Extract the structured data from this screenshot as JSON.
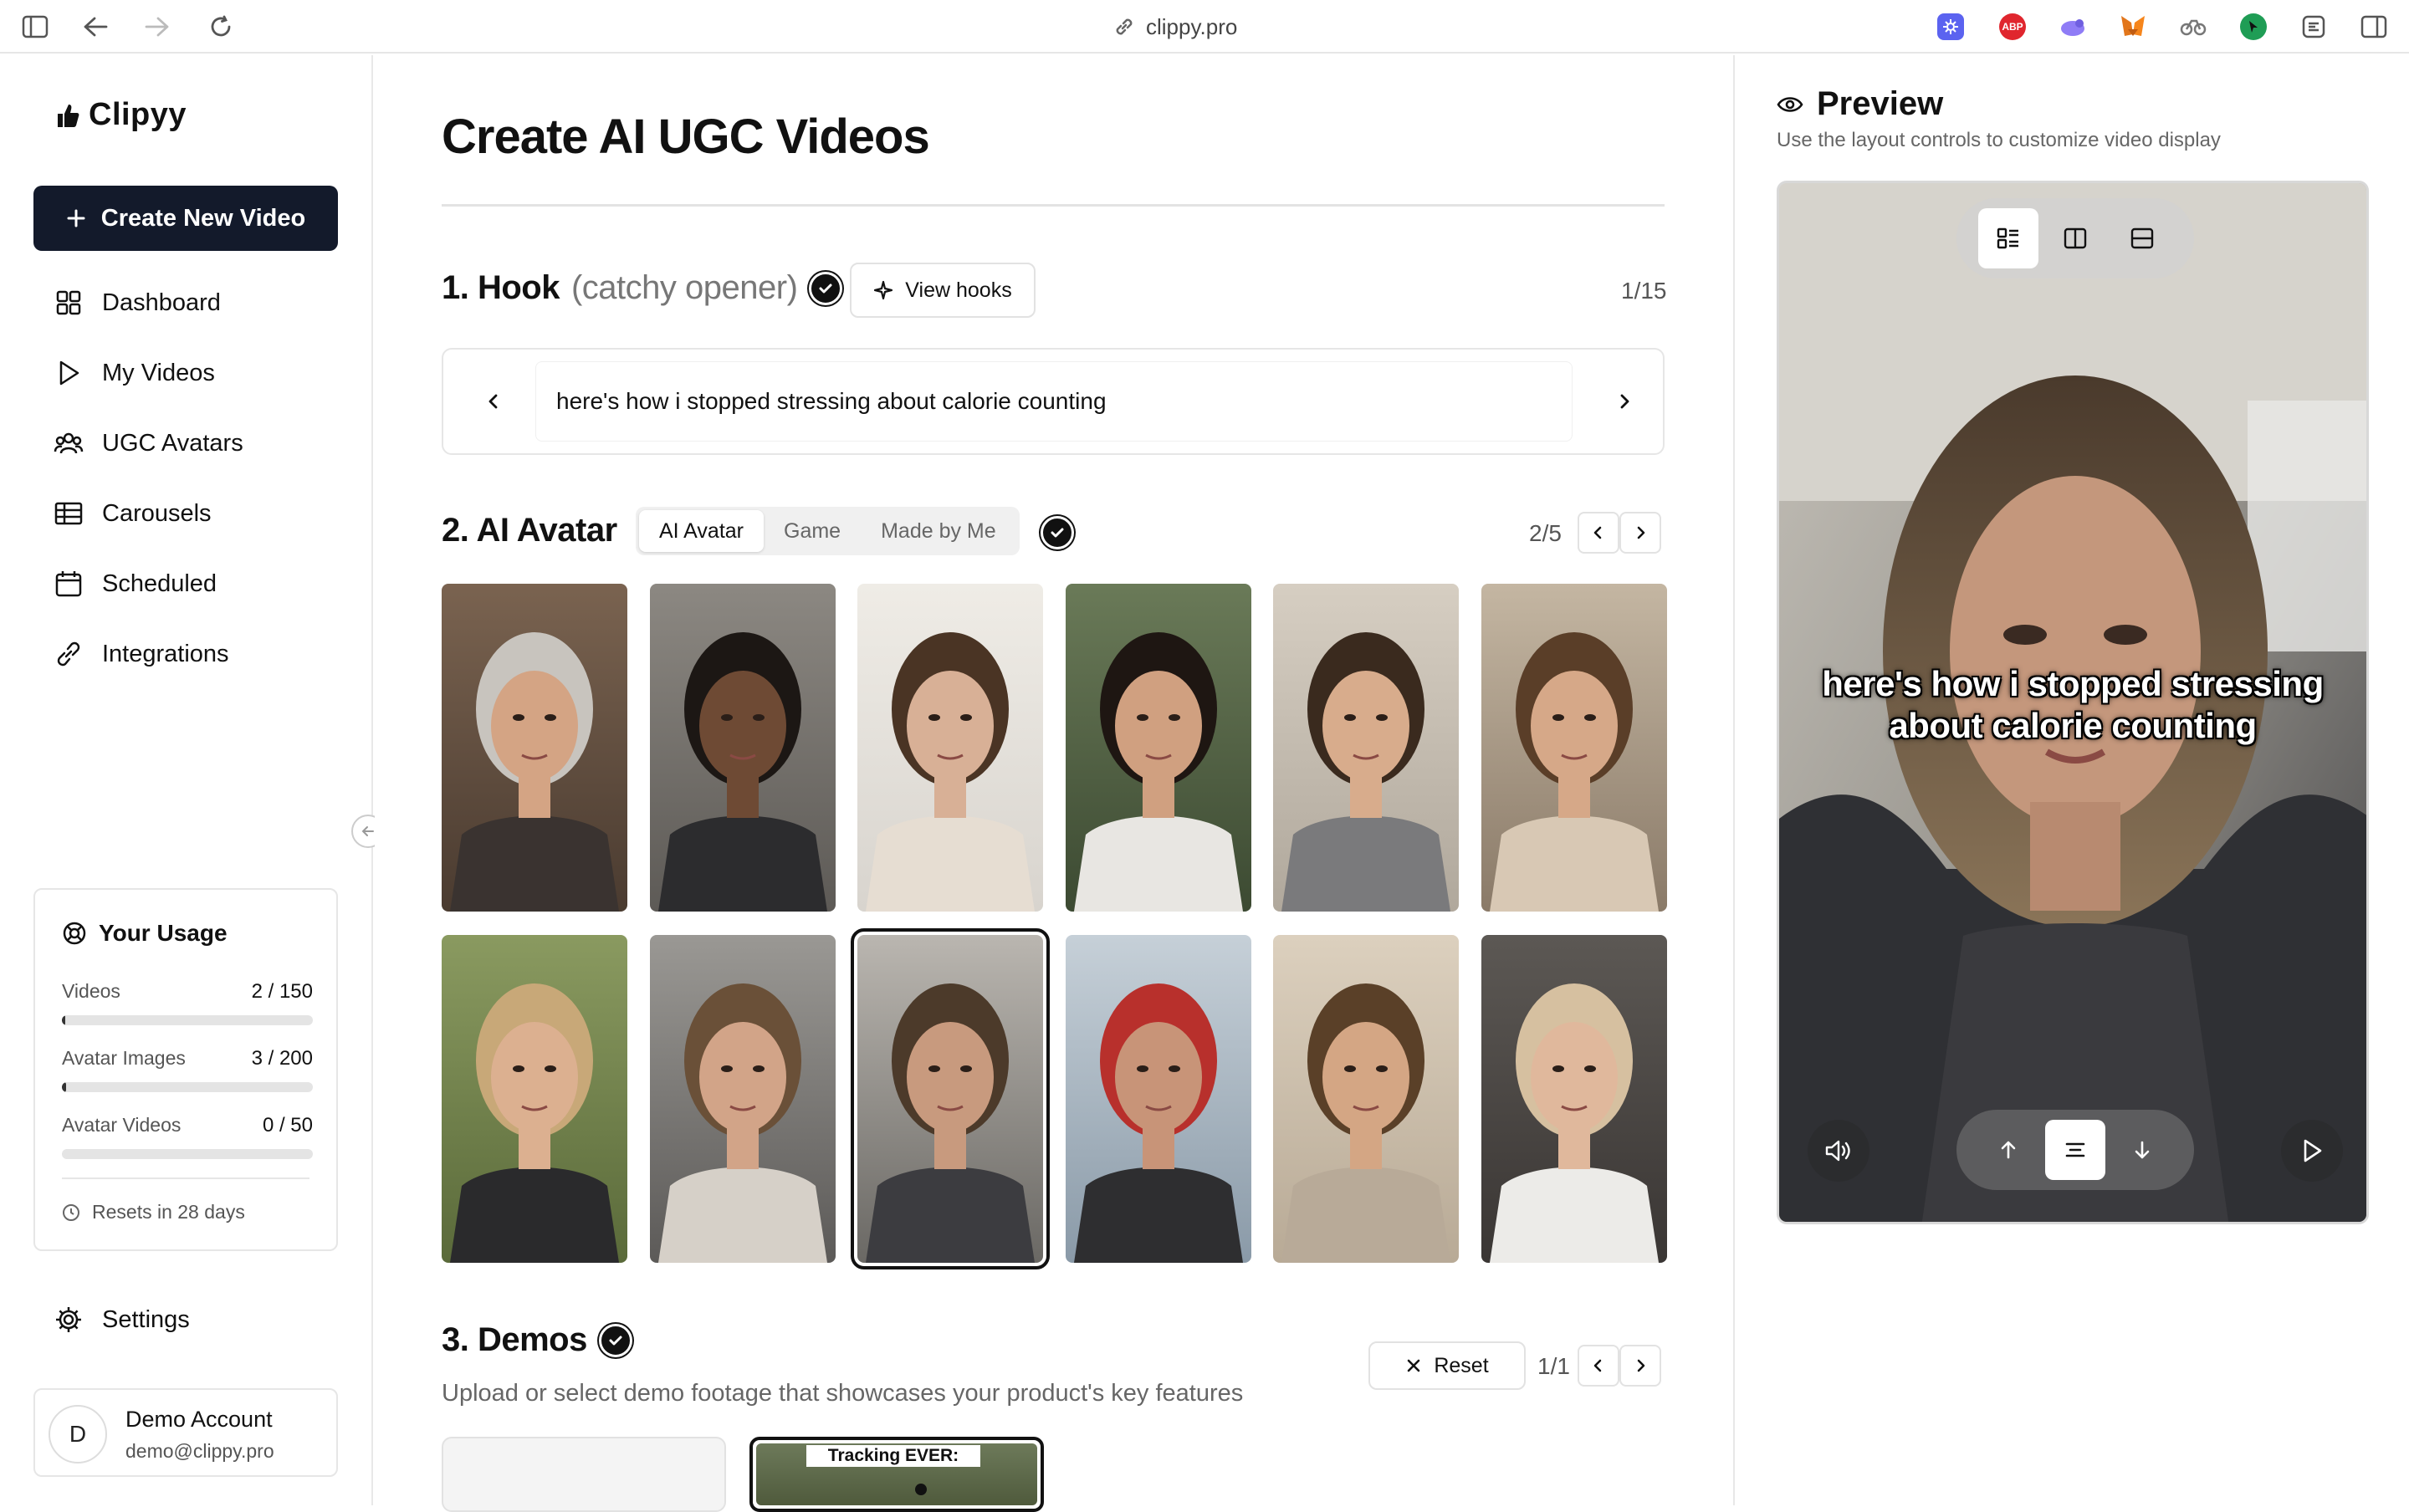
{
  "browser": {
    "url": "clippy.pro",
    "extensions": [
      "extension-icon",
      "abp-icon",
      "extension-icon",
      "metamask-icon",
      "extension-icon",
      "extension-icon",
      "extension-icon"
    ],
    "abp_label": "ABP"
  },
  "sidebar": {
    "brand": "Clipyy",
    "create_label": "Create New Video",
    "items": [
      {
        "label": "Dashboard",
        "icon": "grid-icon"
      },
      {
        "label": "My Videos",
        "icon": "play-icon"
      },
      {
        "label": "UGC Avatars",
        "icon": "users-icon"
      },
      {
        "label": "Carousels",
        "icon": "table-icon"
      },
      {
        "label": "Scheduled",
        "icon": "calendar-icon"
      },
      {
        "label": "Integrations",
        "icon": "link-icon"
      }
    ],
    "usage": {
      "title": "Your Usage",
      "rows": [
        {
          "label": "Videos",
          "value": "2 / 150",
          "fraction": 0.0133
        },
        {
          "label": "Avatar Images",
          "value": "3 / 200",
          "fraction": 0.015
        },
        {
          "label": "Avatar Videos",
          "value": "0 / 50",
          "fraction": 0
        }
      ],
      "resets": "Resets in 28 days"
    },
    "settings_label": "Settings",
    "account": {
      "initial": "D",
      "name": "Demo Account",
      "email": "demo@clippy.pro"
    }
  },
  "main": {
    "title": "Create AI UGC Videos",
    "hook": {
      "title": "1. Hook",
      "subtitle": "(catchy opener)",
      "view_hooks": "View hooks",
      "counter": "1/15",
      "text": "here's how i stopped stressing about calorie counting"
    },
    "avatar": {
      "title": "2. AI Avatar",
      "tabs": [
        "AI Avatar",
        "Game",
        "Made by Me"
      ],
      "active_tab": 0,
      "counter": "2/5",
      "selected_index": 8,
      "tiles": [
        {
          "name": "avatar-older-man-restaurant"
        },
        {
          "name": "avatar-man-dreadlocks-car"
        },
        {
          "name": "avatar-woman-white-top"
        },
        {
          "name": "avatar-woman-selfie-outdoor"
        },
        {
          "name": "avatar-woman-grey-tee"
        },
        {
          "name": "avatar-woman-glasses-cafe"
        },
        {
          "name": "avatar-woman-forest-hiker"
        },
        {
          "name": "avatar-woman-surprised-car"
        },
        {
          "name": "avatar-woman-car-selfie"
        },
        {
          "name": "avatar-man-red-cap"
        },
        {
          "name": "avatar-man-hoodie-coffee"
        },
        {
          "name": "avatar-woman-blonde-shocked"
        }
      ]
    },
    "demos": {
      "title": "3. Demos",
      "reset": "Reset",
      "counter": "1/1",
      "description": "Upload or select demo footage that showcases your product's key features",
      "card_caption": "Tracking EVER:"
    }
  },
  "preview": {
    "title": "Preview",
    "subtitle": "Use the layout controls to customize video display",
    "caption": "here's how i stopped stressing about calorie counting",
    "layout_active": 0,
    "position_active": 1
  }
}
